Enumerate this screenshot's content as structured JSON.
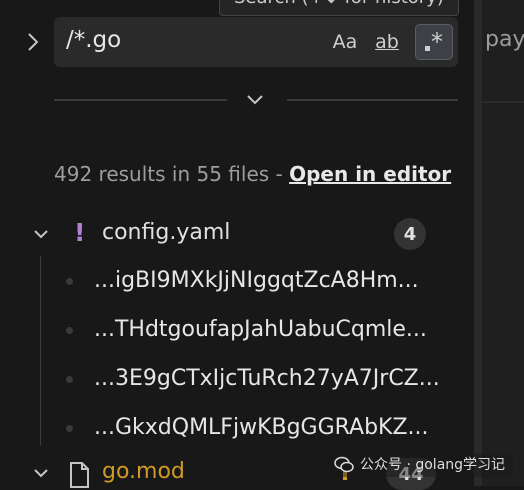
{
  "tooltip": {
    "text": "Search (↑↓ for history)"
  },
  "editor": {
    "text_fragment": "pay"
  },
  "search": {
    "value": "/*.go",
    "options": {
      "match_case_label": "Aa",
      "whole_word_label": "ab",
      "regex_label": "*",
      "regex_active": true
    }
  },
  "results": {
    "summary": "492 results in 55 files - ",
    "open_in_editor": "Open in editor"
  },
  "files": [
    {
      "name": "config.yaml",
      "icon": "exclamation-icon",
      "count": "4",
      "matches": [
        "...igBI9MXkJjNIggqtZcA8Hm...",
        "...THdtgoufapJahUabuCqmle...",
        "...3E9gCTxIjcTuRch27yA7JrCZ...",
        "...GkxdQMLFjwKBgGGRAbKZ..."
      ]
    },
    {
      "name": "go.mod",
      "icon": "file-icon",
      "count": "44"
    }
  ],
  "watermark": {
    "text": "公众号 · golang学习记"
  },
  "colors": {
    "background": "#181818",
    "input": "#2a2a2a",
    "modified_file": "#d19a27",
    "warning_icon": "#b180d7"
  }
}
